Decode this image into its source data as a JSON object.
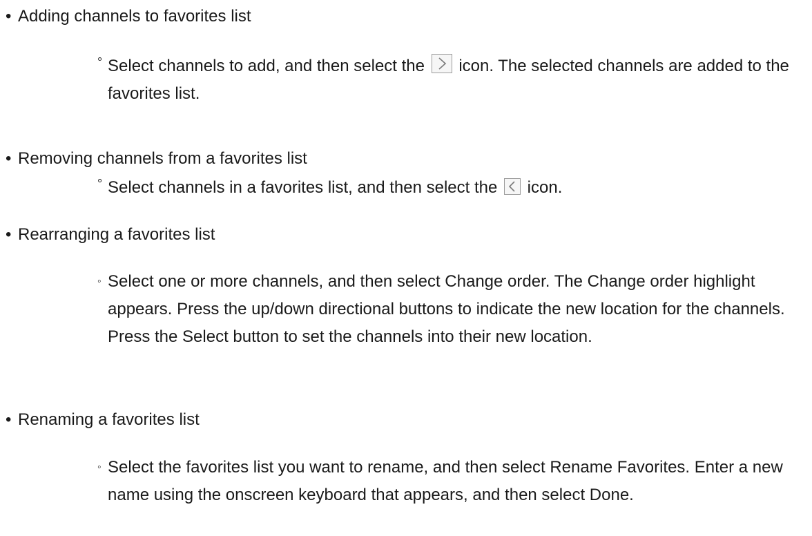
{
  "items": [
    {
      "heading": "Adding channels to favorites list",
      "sub_mark": "°",
      "sub_before_icon": "Select channels to add, and then select the",
      "icon": "chevron-right-icon",
      "sub_after_icon": "icon. The selected channels are added to the favorites list."
    },
    {
      "heading": "Removing channels from a favorites list",
      "sub_mark": "°",
      "sub_before_icon": "Select channels in a favorites list, and then select the",
      "icon": "chevron-left-icon",
      "sub_after_icon": "icon."
    },
    {
      "heading": "Rearranging a favorites list",
      "sub_mark": "◦",
      "sub_text": "Select one or more channels, and then select Change order. The Change order highlight appears. Press the up/down directional buttons to indicate the new location for the channels. Press the Select button to set the channels into their new location."
    },
    {
      "heading": "Renaming a favorites list",
      "sub_mark": "◦",
      "sub_text": "Select the favorites list you want to rename, and then select Rename Favorites. Enter a new name using the onscreen keyboard that appears, and then select Done."
    }
  ],
  "bullet": "•"
}
